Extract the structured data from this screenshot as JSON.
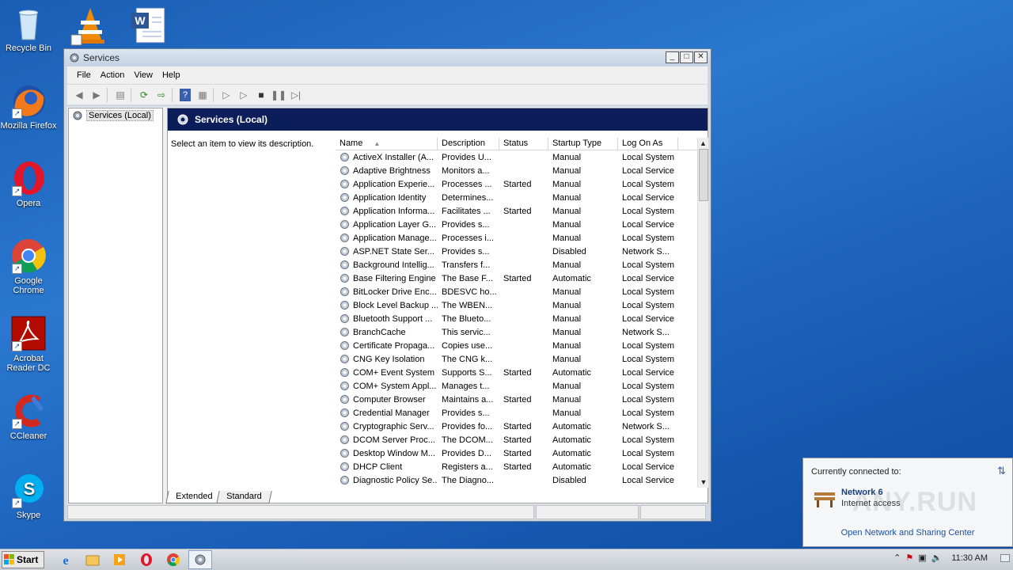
{
  "desktop": {
    "icons": [
      {
        "label": "Recycle Bin",
        "icon": "recycle-bin-icon"
      },
      {
        "label": "Mozilla Firefox",
        "icon": "firefox-icon"
      },
      {
        "label": "Opera",
        "icon": "opera-icon"
      },
      {
        "label": "Google Chrome",
        "icon": "chrome-icon"
      },
      {
        "label": "Acrobat Reader DC",
        "icon": "acrobat-icon"
      },
      {
        "label": "CCleaner",
        "icon": "ccleaner-icon"
      },
      {
        "label": "Skype",
        "icon": "skype-icon"
      }
    ]
  },
  "window": {
    "title": "Services",
    "menu": [
      "File",
      "Action",
      "View",
      "Help"
    ],
    "tree": {
      "root": "Services (Local)"
    },
    "panel_title": "Services (Local)",
    "description_prompt": "Select an item to view its description.",
    "columns": [
      "Name",
      "Description",
      "Status",
      "Startup Type",
      "Log On As"
    ],
    "rows": [
      [
        "ActiveX Installer (A...",
        "Provides U...",
        "",
        "Manual",
        "Local System"
      ],
      [
        "Adaptive Brightness",
        "Monitors a...",
        "",
        "Manual",
        "Local Service"
      ],
      [
        "Application Experie...",
        "Processes ...",
        "Started",
        "Manual",
        "Local System"
      ],
      [
        "Application Identity",
        "Determines...",
        "",
        "Manual",
        "Local Service"
      ],
      [
        "Application Informa...",
        "Facilitates ...",
        "Started",
        "Manual",
        "Local System"
      ],
      [
        "Application Layer G...",
        "Provides s...",
        "",
        "Manual",
        "Local Service"
      ],
      [
        "Application Manage...",
        "Processes i...",
        "",
        "Manual",
        "Local System"
      ],
      [
        "ASP.NET State Ser...",
        "Provides s...",
        "",
        "Disabled",
        "Network S..."
      ],
      [
        "Background Intellig...",
        "Transfers f...",
        "",
        "Manual",
        "Local System"
      ],
      [
        "Base Filtering Engine",
        "The Base F...",
        "Started",
        "Automatic",
        "Local Service"
      ],
      [
        "BitLocker Drive Enc...",
        "BDESVC ho...",
        "",
        "Manual",
        "Local System"
      ],
      [
        "Block Level Backup ...",
        "The WBEN...",
        "",
        "Manual",
        "Local System"
      ],
      [
        "Bluetooth Support ...",
        "The Blueto...",
        "",
        "Manual",
        "Local Service"
      ],
      [
        "BranchCache",
        "This servic...",
        "",
        "Manual",
        "Network S..."
      ],
      [
        "Certificate Propaga...",
        "Copies use...",
        "",
        "Manual",
        "Local System"
      ],
      [
        "CNG Key Isolation",
        "The CNG k...",
        "",
        "Manual",
        "Local System"
      ],
      [
        "COM+ Event System",
        "Supports S...",
        "Started",
        "Automatic",
        "Local Service"
      ],
      [
        "COM+ System Appl...",
        "Manages t...",
        "",
        "Manual",
        "Local System"
      ],
      [
        "Computer Browser",
        "Maintains a...",
        "Started",
        "Manual",
        "Local System"
      ],
      [
        "Credential Manager",
        "Provides s...",
        "",
        "Manual",
        "Local System"
      ],
      [
        "Cryptographic Serv...",
        "Provides fo...",
        "Started",
        "Automatic",
        "Network S..."
      ],
      [
        "DCOM Server Proc...",
        "The DCOM...",
        "Started",
        "Automatic",
        "Local System"
      ],
      [
        "Desktop Window M...",
        "Provides D...",
        "Started",
        "Automatic",
        "Local System"
      ],
      [
        "DHCP Client",
        "Registers a...",
        "Started",
        "Automatic",
        "Local Service"
      ],
      [
        "Diagnostic Policy Se...",
        "The Diagno...",
        "",
        "Disabled",
        "Local Service"
      ]
    ],
    "tabs": [
      "Extended",
      "Standard"
    ]
  },
  "network_flyout": {
    "header": "Currently connected to:",
    "network_name": "Network  6",
    "access": "Internet access",
    "link": "Open Network and Sharing Center",
    "watermark": "ANY.RUN"
  },
  "taskbar": {
    "start_label": "Start",
    "clock": "11:30 AM"
  }
}
